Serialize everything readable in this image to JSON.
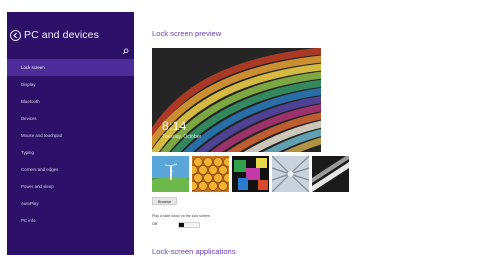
{
  "sidebar": {
    "title": "PC and devices",
    "items": [
      {
        "label": "Lock screen",
        "active": true
      },
      {
        "label": "Display"
      },
      {
        "label": "Bluetooth"
      },
      {
        "label": "Devices"
      },
      {
        "label": "Mouse and touchpad"
      },
      {
        "label": "Typing"
      },
      {
        "label": "Corners and edges"
      },
      {
        "label": "Power and sleep"
      },
      {
        "label": "AutoPlay"
      },
      {
        "label": "PC info"
      }
    ]
  },
  "main": {
    "preview_heading": "Lock screen preview",
    "preview_time": "8:14",
    "preview_date": "Tuesday, October",
    "browse_label": "Browse",
    "slideshow_label": "Play a slide show on the lock screen",
    "slideshow_state": "Off",
    "apps_heading": "Lock-screen applications"
  },
  "colors": {
    "sidebar_bg": "#2d1168",
    "sidebar_active": "#4e2d9a",
    "accent": "#6a3fb6"
  }
}
